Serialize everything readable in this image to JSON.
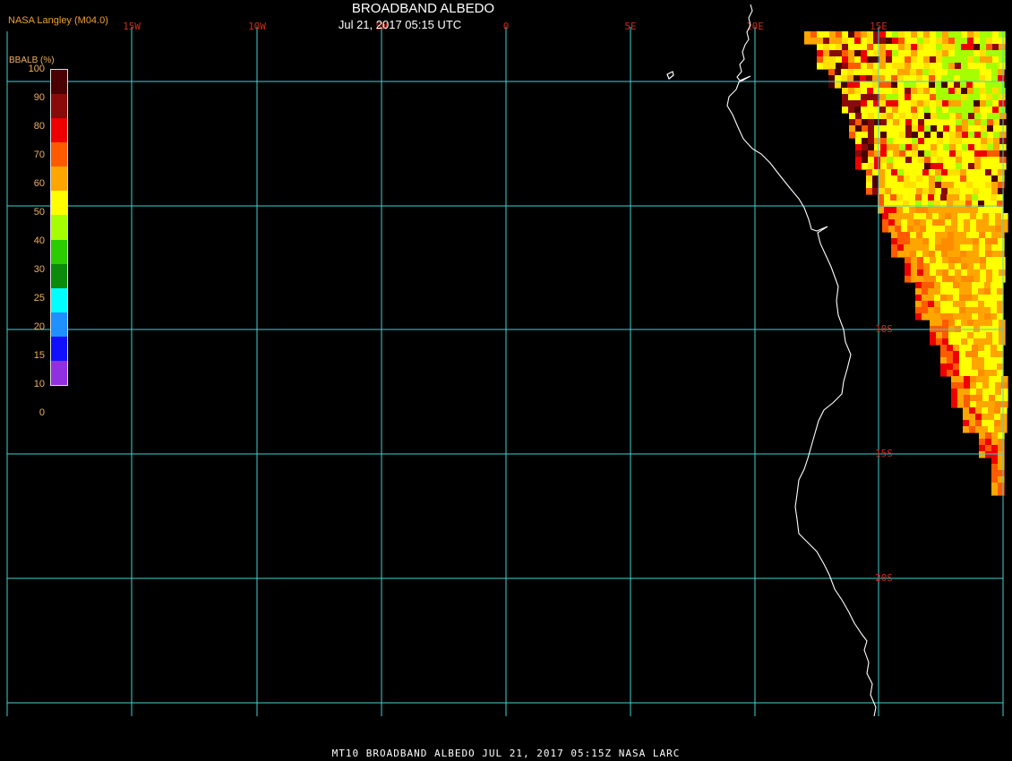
{
  "header": {
    "title": "BROADBAND ALBEDO",
    "subtitle": "Jul 21, 2017 05:15 UTC",
    "credit": "NASA Langley (M04.0)"
  },
  "legend": {
    "title": "BBALB (%)",
    "ticks": [
      "100",
      "90",
      "80",
      "70",
      "60",
      "50",
      "40",
      "30",
      "25",
      "20",
      "15",
      "10",
      "0"
    ],
    "colors": [
      "#4a0000",
      "#8a0a0a",
      "#ee0000",
      "#ff5a00",
      "#ffa500",
      "#ffff00",
      "#a6ff00",
      "#2bcc00",
      "#0b8a0b",
      "#00ffff",
      "#1e90ff",
      "#1010ff",
      "#9030e0"
    ]
  },
  "grid": {
    "lon_labels": [
      "15W",
      "10W",
      "5W",
      "0",
      "5E",
      "10E",
      "15E"
    ],
    "lat_labels": [
      "10S",
      "15S",
      "20S"
    ],
    "line_color": "#44d0d0",
    "label_color": "#cc2a1a"
  },
  "footer": {
    "text": "MT10  BROADBAND ALBEDO   JUL 21, 2017 05:15Z   NASA LARC"
  }
}
